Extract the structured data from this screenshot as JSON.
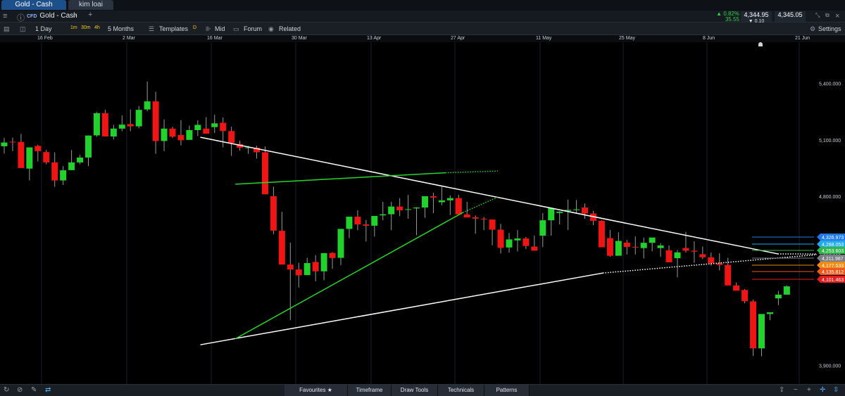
{
  "tabs": [
    {
      "label": "Gold - Cash",
      "active": true
    },
    {
      "label": "kim loai",
      "active": false
    }
  ],
  "titlebar": {
    "cfd": "CFD",
    "symbol": "Gold - Cash",
    "change_pct": "▲ 0.82%",
    "change_abs": "35.55",
    "sell": "4,344.95",
    "buy": "4,345.05",
    "spread": "▼ 0.10"
  },
  "toolbar": {
    "interval": "1 Day",
    "intervals": [
      "1m",
      "30m",
      "4h"
    ],
    "range": "5 Months",
    "templates": "Templates",
    "d": "D",
    "mid": "Mid",
    "forum": "Forum",
    "related": "Related",
    "settings": "Settings"
  },
  "x_axis_labels": [
    "16 Feb",
    "2 Mar",
    "16 Mar",
    "30 Mar",
    "13 Apr",
    "27 Apr",
    "11 May",
    "25 May",
    "8 Jun",
    "21 Jun"
  ],
  "price_tags": [
    {
      "text": "4,326.973",
      "color": "#1f7ae8"
    },
    {
      "text": "4,288.053",
      "color": "#22aaf0"
    },
    {
      "text": "4,253.603",
      "color": "#2fb84a"
    },
    {
      "text": "4,211.987",
      "color": "#7a7f86"
    },
    {
      "text": "4,177.533",
      "color": "#f08a12"
    },
    {
      "text": "4,135.812",
      "color": "#ee5a1c"
    },
    {
      "text": "4,101.463",
      "color": "#e41e1e"
    }
  ],
  "bottom": {
    "favourites": "Favourites",
    "timeframe": "Timeframe",
    "draw_tools": "Draw Tools",
    "technicals": "Technicals",
    "patterns": "Patterns"
  },
  "chart_data": {
    "type": "candlestick",
    "ylim": [
      3800,
      5620
    ],
    "y_ticks": [
      5400,
      5100,
      4800,
      4500,
      3900
    ],
    "y_tick_labels": [
      "5,400.000",
      "5,100.000",
      "4,800.000",
      "4,500.000",
      "3,900.000"
    ],
    "bull_color": "#21d12c",
    "bear_color": "#f01515",
    "candles": [
      [
        5066,
        5110,
        5027,
        5086
      ],
      [
        5090,
        5112,
        5040,
        5089
      ],
      [
        5089,
        5132,
        4950,
        4950
      ],
      [
        4947,
        5058,
        4884,
        5060
      ],
      [
        5068,
        5074,
        4985,
        5040
      ],
      [
        5035,
        5047,
        4970,
        4980
      ],
      [
        4980,
        5034,
        4850,
        4884
      ],
      [
        4884,
        4960,
        4860,
        4938
      ],
      [
        4939,
        5046,
        4938,
        4980
      ],
      [
        4980,
        5020,
        4970,
        5006
      ],
      [
        5006,
        5124,
        4960,
        5123
      ],
      [
        5124,
        5249,
        5116,
        5242
      ],
      [
        5242,
        5260,
        5146,
        5118
      ],
      [
        5118,
        5180,
        5102,
        5160
      ],
      [
        5160,
        5230,
        5146,
        5181
      ],
      [
        5184,
        5262,
        5146,
        5172
      ],
      [
        5172,
        5280,
        5161,
        5260
      ],
      [
        5262,
        5410,
        5252,
        5305
      ],
      [
        5305,
        5356,
        5026,
        5094
      ],
      [
        5094,
        5209,
        5040,
        5160
      ],
      [
        5160,
        5170,
        5110,
        5117
      ],
      [
        5126,
        5205,
        5071,
        5098
      ],
      [
        5100,
        5176,
        5100,
        5152
      ],
      [
        5152,
        5204,
        5120,
        5180
      ],
      [
        5160,
        5221,
        5140,
        5133
      ],
      [
        5168,
        5234,
        5137,
        5188
      ],
      [
        5191,
        5219,
        5060,
        5147
      ],
      [
        5147,
        5170,
        5015,
        5083
      ],
      [
        5078,
        5096,
        5042,
        5058
      ],
      [
        5060,
        5068,
        5026,
        5060
      ],
      [
        5058,
        5068,
        5001,
        5034
      ],
      [
        5034,
        5065,
        4810,
        4810
      ],
      [
        4800,
        4851,
        4598,
        4617
      ],
      [
        4616,
        4717,
        4443,
        4436
      ],
      [
        4436,
        4553,
        4140,
        4410
      ],
      [
        4410,
        4446,
        4314,
        4379
      ],
      [
        4380,
        4472,
        4394,
        4444
      ],
      [
        4450,
        4486,
        4347,
        4400
      ],
      [
        4400,
        4460,
        4353,
        4497
      ],
      [
        4498,
        4502,
        4413,
        4471
      ],
      [
        4472,
        4511,
        4433,
        4626
      ],
      [
        4626,
        4672,
        4577,
        4691
      ],
      [
        4691,
        4725,
        4619,
        4650
      ],
      [
        4650,
        4674,
        4559,
        4643
      ],
      [
        4643,
        4694,
        4585,
        4695
      ],
      [
        4698,
        4770,
        4672,
        4704
      ],
      [
        4704,
        4770,
        4619,
        4745
      ],
      [
        4745,
        4790,
        4694,
        4725
      ],
      [
        4728,
        4807,
        4680,
        4731
      ],
      [
        4735,
        4742,
        4592,
        4740
      ],
      [
        4740,
        4788,
        4685,
        4800
      ],
      [
        4800,
        4818,
        4710,
        4793
      ],
      [
        4768,
        4850,
        4752,
        4778
      ],
      [
        4778,
        4804,
        4700,
        4790
      ],
      [
        4790,
        4808,
        4730,
        4703
      ],
      [
        4703,
        4770,
        4690,
        4687
      ],
      [
        4688,
        4698,
        4600,
        4681
      ],
      [
        4680,
        4690,
        4619,
        4676
      ],
      [
        4676,
        4674,
        4539,
        4622
      ],
      [
        4622,
        4653,
        4495,
        4525
      ],
      [
        4527,
        4604,
        4500,
        4570
      ],
      [
        4565,
        4620,
        4506,
        4575
      ],
      [
        4575,
        4583,
        4519,
        4535
      ],
      [
        4532,
        4590,
        4520,
        4510
      ],
      [
        4590,
        4710,
        4529,
        4672
      ],
      [
        4672,
        4733,
        4590,
        4737
      ],
      [
        4711,
        4720,
        4650,
        4718
      ],
      [
        4722,
        4782,
        4620,
        4727
      ],
      [
        4726,
        4780,
        4708,
        4730
      ],
      [
        4740,
        4761,
        4680,
        4708
      ],
      [
        4708,
        4722,
        4646,
        4669
      ],
      [
        4669,
        4672,
        4539,
        4528
      ],
      [
        4577,
        4620,
        4478,
        4483
      ],
      [
        4483,
        4608,
        4517,
        4562
      ],
      [
        4553,
        4568,
        4490,
        4530
      ],
      [
        4530,
        4586,
        4490,
        4529
      ],
      [
        4524,
        4580,
        4469,
        4552
      ],
      [
        4552,
        4578,
        4507,
        4580
      ],
      [
        4524,
        4550,
        4478,
        4538
      ],
      [
        4512,
        4538,
        4473,
        4448
      ],
      [
        4470,
        4513,
        4368,
        4501
      ],
      [
        4524,
        4610,
        4500,
        4510
      ],
      [
        4510,
        4560,
        4445,
        4505
      ],
      [
        4491,
        4532,
        4465,
        4475
      ],
      [
        4475,
        4500,
        4430,
        4443
      ],
      [
        4443,
        4496,
        4405,
        4434
      ],
      [
        4434,
        4472,
        4350,
        4325
      ],
      [
        4325,
        4340,
        4306,
        4297
      ],
      [
        4301,
        4306,
        4230,
        4241
      ],
      [
        4240,
        4250,
        3950,
        3990
      ],
      [
        3990,
        4100,
        3948,
        4173
      ],
      [
        4173,
        4176,
        4140,
        4182
      ],
      [
        4256,
        4296,
        4220,
        4276
      ],
      [
        4276,
        4325,
        4275,
        4320
      ]
    ],
    "trendlines": [
      {
        "from": [
          10,
          5114
        ],
        "to": [
          43,
          4493
        ],
        "color": "#ffffff",
        "dotted_to": [
          46,
          4492
        ]
      },
      {
        "from": [
          10,
          4009
        ],
        "to": [
          33,
          4391
        ],
        "color": "#ffffff",
        "dotted_to": [
          46,
          4495
        ]
      },
      {
        "from": [
          12,
          4864
        ],
        "to": [
          24,
          4925
        ],
        "color": "#2bd42b",
        "dotted_to": [
          27,
          4934
        ]
      },
      {
        "from": [
          12,
          4041
        ],
        "to": [
          25,
          4713
        ],
        "color": "#2bd42b",
        "dotted_to": [
          27,
          4795
        ]
      }
    ]
  }
}
